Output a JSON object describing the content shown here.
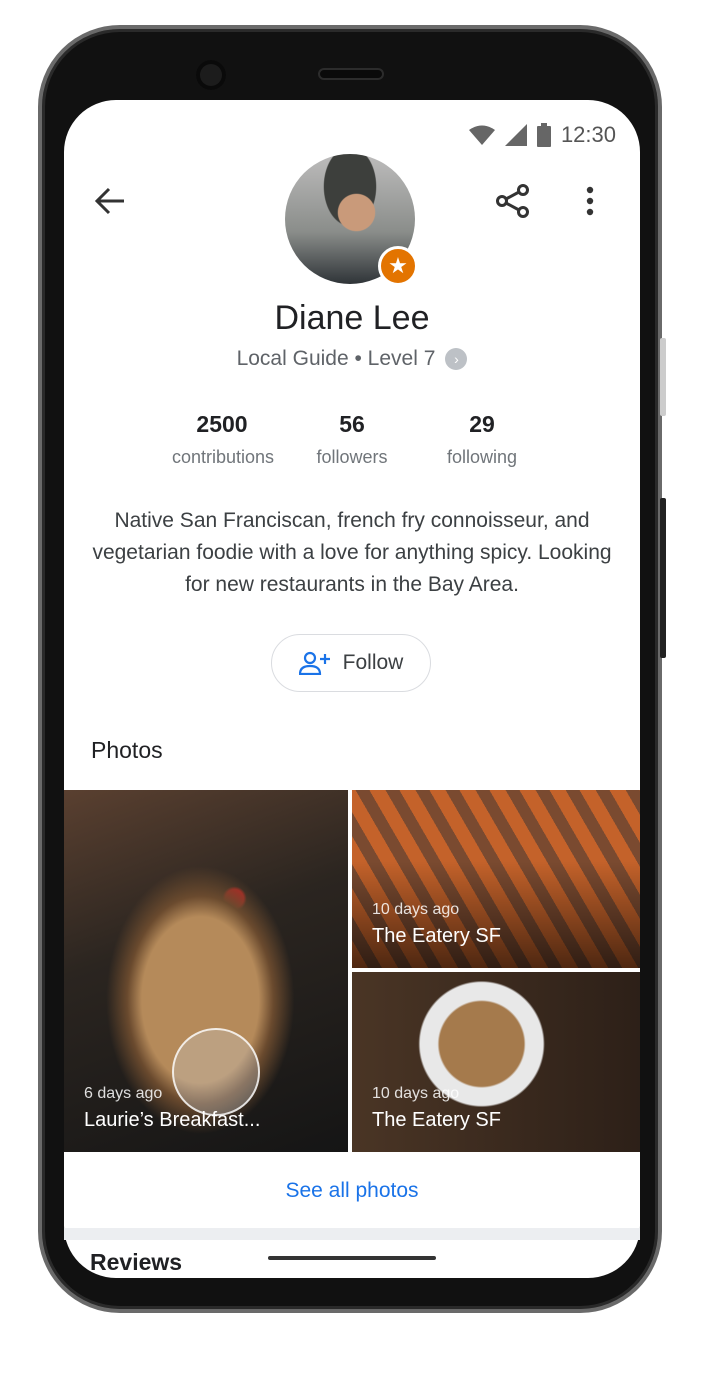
{
  "status_bar": {
    "time": "12:30",
    "icons": [
      "wifi-icon",
      "signal-icon",
      "battery-icon"
    ]
  },
  "toolbar": {
    "back_icon": "arrow-left-icon",
    "share_icon": "share-icon",
    "more_icon": "more-vert-icon"
  },
  "profile": {
    "name": "Diane Lee",
    "level": "Local Guide • Level 7",
    "badge_icon": "star-icon",
    "badge_color": "#e37400",
    "stats": [
      {
        "value": "2500",
        "label": "contributions"
      },
      {
        "value": "56",
        "label": "followers"
      },
      {
        "value": "29",
        "label": "following"
      }
    ],
    "bio": "Native San Franciscan, french fry connoisseur, and vegetarian foodie with a love for anything spicy. Looking for new restaurants in the Bay Area.",
    "follow_label": "Follow"
  },
  "photos": {
    "title": "Photos",
    "items": [
      {
        "date": "6 days ago",
        "place": "Laurie’s Breakfast..."
      },
      {
        "date": "10 days ago",
        "place": "The Eatery SF"
      },
      {
        "date": "10 days ago",
        "place": "The Eatery SF"
      }
    ],
    "see_all": "See all photos"
  },
  "reviews": {
    "title": "Reviews"
  },
  "accent": "#1a73e8"
}
